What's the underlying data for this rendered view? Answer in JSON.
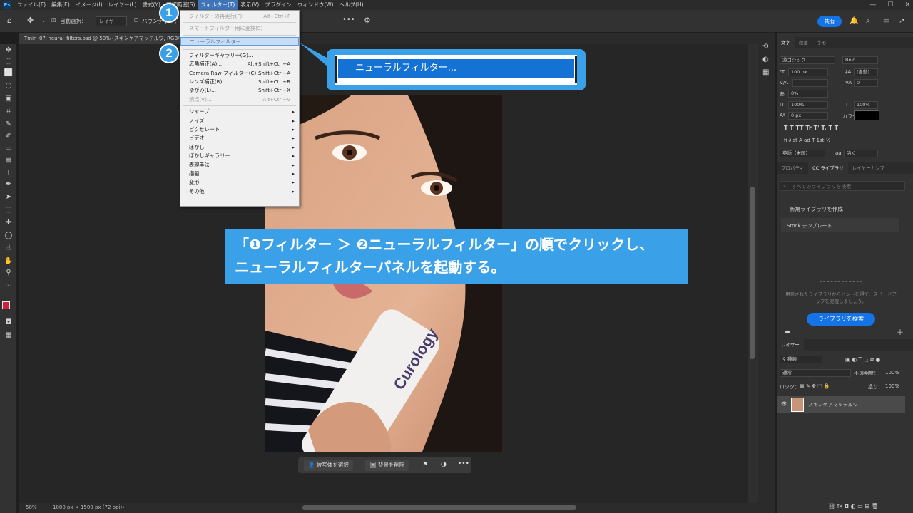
{
  "app": {
    "logo": "Ps"
  },
  "menubar": {
    "items": [
      "ファイル(F)",
      "編集(E)",
      "イメージ(I)",
      "レイヤー(L)",
      "書式(Y)",
      "選択範囲(S)",
      "フィルター(T)",
      "表示(V)",
      "プラグイン",
      "ウィンドウ(W)",
      "ヘルプ(H)"
    ],
    "active_index": 6
  },
  "options": {
    "auto_select": "自動選択：",
    "layer_select": "レイヤー",
    "transform": "バウンディング",
    "more": "•••",
    "share": "共有"
  },
  "document": {
    "tab": "Tmin_07_neural_filters.psd @ 50% (スキンケアマッテルワ, RGB/8)"
  },
  "filter_menu": {
    "items": [
      {
        "label": "フィルターの再実行(F)",
        "shortcut": "Alt+Ctrl+F",
        "disabled": true
      },
      {
        "sep": true
      },
      {
        "label": "スマートフィルター用に変換(S)",
        "disabled": true
      },
      {
        "sep": true
      },
      {
        "label": "ニューラルフィルター...",
        "highlight": true
      },
      {
        "sep": true
      },
      {
        "label": "フィルターギャラリー(G)..."
      },
      {
        "label": "広角補正(A)...",
        "shortcut": "Alt+Shift+Ctrl+A"
      },
      {
        "label": "Camera Raw フィルター(C)...",
        "shortcut": "Shift+Ctrl+A"
      },
      {
        "label": "レンズ補正(R)...",
        "shortcut": "Shift+Ctrl+R"
      },
      {
        "label": "ゆがみ(L)...",
        "shortcut": "Shift+Ctrl+X"
      },
      {
        "label": "消点(V)...",
        "shortcut": "Alt+Ctrl+V",
        "disabled": true
      },
      {
        "sep": true
      },
      {
        "label": "シャープ",
        "sub": true
      },
      {
        "label": "ノイズ",
        "sub": true
      },
      {
        "label": "ピクセレート",
        "sub": true
      },
      {
        "label": "ビデオ",
        "sub": true
      },
      {
        "label": "ぼかし",
        "sub": true
      },
      {
        "label": "ぼかしギャラリー",
        "sub": true
      },
      {
        "label": "表現手法",
        "sub": true
      },
      {
        "label": "描画",
        "sub": true
      },
      {
        "label": "変形",
        "sub": true
      },
      {
        "label": "その他",
        "sub": true
      }
    ]
  },
  "annotation": {
    "badge1": "1",
    "badge2": "2",
    "callout": "ニューラルフィルター...",
    "instruction_line1": "「❶フィルター ＞ ❷ニューラルフィルター」の順でクリックし、",
    "instruction_line2": "ニューラルフィルターパネルを起動する。"
  },
  "context_bar": {
    "select_subject": "被写体を選択",
    "remove_bg": "背景を削除",
    "more": "•••"
  },
  "status": {
    "zoom": "50%",
    "size": "1000 px × 1500 px (72 ppi)"
  },
  "photo": {
    "brand": "Curology"
  },
  "character_panel": {
    "tabs": [
      "文字",
      "段落",
      "字形"
    ],
    "font": "游ゴシック",
    "style": "Bold",
    "size": "100 px",
    "leading": "(自動)",
    "tracking": "0",
    "tsume": "0%",
    "vscale": "100%",
    "hscale": "100%",
    "baseline": "0 px",
    "color_label": "カラー：",
    "type_buttons": "T  T  TT  Tr  T'  T,  T  Ŧ",
    "lang": "英語（米国）",
    "aa_label": "aa",
    "aa": "強く"
  },
  "library_panel": {
    "tabs": [
      "プロパティ",
      "CC ライブラリ",
      "レイヤーカンプ"
    ],
    "search_placeholder": "すべてのライブラリを検索",
    "new_library": "新規ライブラリを作成",
    "stock": "Stock テンプレート",
    "hint": "用意されたライブラリからヒントを得て、スピードアップを実現しましょう。",
    "search_button": "ライブラリを検索"
  },
  "layers_panel": {
    "title": "レイヤー",
    "kind": "種類",
    "blend": "通常",
    "opacity_label": "不透明度：",
    "opacity": "100%",
    "lock_label": "ロック：",
    "fill_label": "塗り：",
    "fill": "100%",
    "layer_name": "スキンケアマッテルワ"
  }
}
